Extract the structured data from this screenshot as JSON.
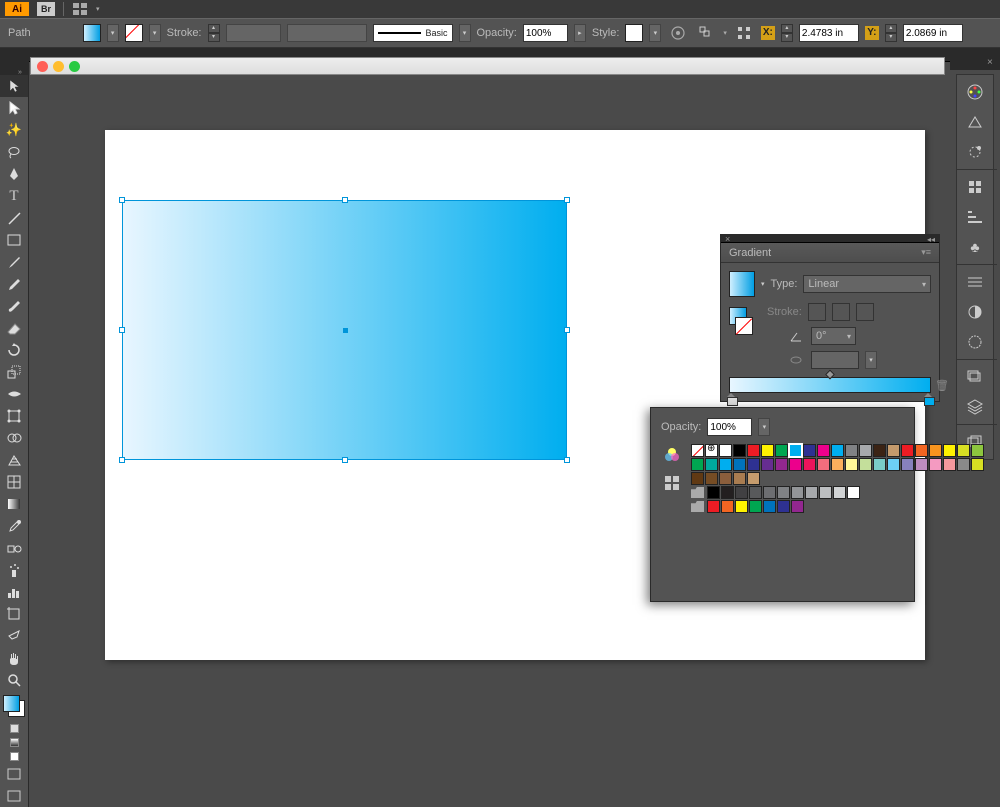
{
  "app": {
    "logo": "Ai",
    "bridge": "Br"
  },
  "control_bar": {
    "selection_label": "Path",
    "stroke_label": "Stroke:",
    "brush_label": "Basic",
    "opacity_label": "Opacity:",
    "opacity_value": "100%",
    "style_label": "Style:",
    "x_label": "X:",
    "x_value": "2.4783 in",
    "y_label": "Y:",
    "y_value": "2.0869 in"
  },
  "gradient_panel": {
    "title": "Gradient",
    "type_label": "Type:",
    "type_value": "Linear",
    "stroke_label": "Stroke:",
    "angle_value": "0°"
  },
  "swatch_panel": {
    "opacity_label": "Opacity:",
    "opacity_value": "100%",
    "rows": [
      [
        "none",
        "reg",
        "#ffffff",
        "#000000",
        "#ed1c24",
        "#fff200",
        "#00a651",
        "#00aeef",
        "#2e3192",
        "#ec008c",
        "#00aeef",
        "#808285",
        "#a7a9ac",
        "#3b2314",
        "#c49a6c",
        "#ed1c24",
        "#f26522",
        "#f7941e",
        "#fff200",
        "#d7df23",
        "#8dc63e"
      ],
      [
        "#00a651",
        "#00a99d",
        "#00aeef",
        "#0072bc",
        "#2e3192",
        "#662d91",
        "#92278f",
        "#ec008c",
        "#ed145b",
        "#f26d7d",
        "#fbaf5d",
        "#fff799",
        "#c4df9b",
        "#7accc8",
        "#6dcff6",
        "#8781bd",
        "#bd8cbf",
        "#f49ac1",
        "#f5989d",
        "#898989",
        "#d7df23"
      ],
      [
        "#603913",
        "#754c24",
        "#8b5e3c",
        "#a97c50",
        "#c69c6d"
      ],
      [
        "#000000",
        "#231f20",
        "#414042",
        "#58595b",
        "#6d6e71",
        "#808285",
        "#939598",
        "#a7a9ac",
        "#bcbec0",
        "#d1d3d4",
        "#ffffff"
      ],
      [
        "#ed1c24",
        "#f26522",
        "#fff200",
        "#00a651",
        "#0072bc",
        "#2e3192",
        "#92278f"
      ]
    ]
  },
  "tools": [
    "selection",
    "direct-selection",
    "magic-wand",
    "lasso",
    "pen",
    "type",
    "line",
    "rectangle",
    "paintbrush",
    "pencil",
    "blob-brush",
    "eraser",
    "rotate",
    "scale",
    "width",
    "free-transform",
    "shape-builder",
    "perspective",
    "mesh",
    "gradient",
    "eyedropper",
    "blend",
    "symbol-sprayer",
    "column-graph",
    "artboard",
    "slice",
    "hand",
    "zoom"
  ],
  "right_panels": [
    "color",
    "swatches",
    "brushes",
    "symbols",
    "stroke",
    "appearance",
    "graphic-styles",
    "transparency",
    "gradient",
    "layers",
    "artboards"
  ]
}
